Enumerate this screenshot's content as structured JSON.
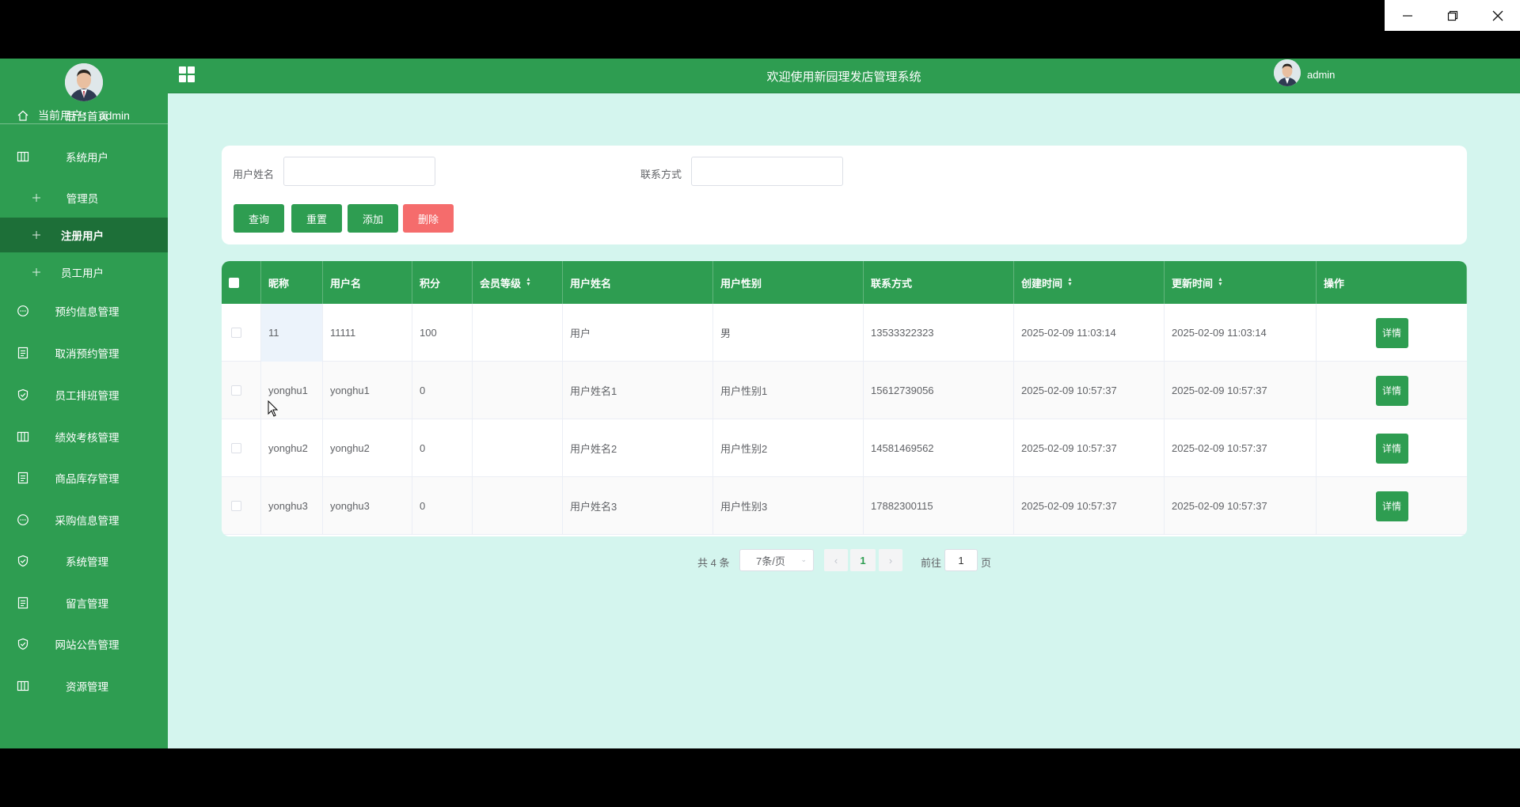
{
  "window": {
    "controls": [
      "minimize",
      "restore",
      "close"
    ]
  },
  "topbar": {
    "title": "欢迎使用新园理发店管理系统",
    "username": "admin"
  },
  "sidebar": {
    "current_user_label": "当前用户：",
    "current_user": "admin",
    "items": [
      {
        "label": "后台首页",
        "icon": "home-icon"
      },
      {
        "label": "系统用户",
        "icon": "columns-icon"
      },
      {
        "label": "管理员",
        "icon": "plus-icon",
        "sub": true
      },
      {
        "label": "注册用户",
        "icon": "plus-icon",
        "sub": true,
        "active": true
      },
      {
        "label": "员工用户",
        "icon": "plus-icon",
        "sub": true
      },
      {
        "label": "预约信息管理",
        "icon": "chat-icon"
      },
      {
        "label": "取消预约管理",
        "icon": "document-icon"
      },
      {
        "label": "员工排班管理",
        "icon": "shield-icon"
      },
      {
        "label": "绩效考核管理",
        "icon": "columns-icon"
      },
      {
        "label": "商品库存管理",
        "icon": "document-icon"
      },
      {
        "label": "采购信息管理",
        "icon": "chat-icon"
      },
      {
        "label": "系统管理",
        "icon": "shield-icon"
      },
      {
        "label": "留言管理",
        "icon": "document-icon"
      },
      {
        "label": "网站公告管理",
        "icon": "shield-icon"
      },
      {
        "label": "资源管理",
        "icon": "columns-icon"
      }
    ]
  },
  "search": {
    "name_label": "用户姓名",
    "name_value": "",
    "contact_label": "联系方式",
    "contact_value": "",
    "buttons": {
      "query": "查询",
      "reset": "重置",
      "add": "添加",
      "delete": "删除"
    }
  },
  "table": {
    "columns": [
      "昵称",
      "用户名",
      "积分",
      "会员等级",
      "用户姓名",
      "用户性别",
      "联系方式",
      "创建时间",
      "更新时间",
      "操作"
    ],
    "detail_label": "详情",
    "rows": [
      {
        "nickname": "11",
        "username": "11111",
        "points": "100",
        "level": "",
        "realname": "用户",
        "gender": "男",
        "phone": "13533322323",
        "created": "2025-02-09 11:03:14",
        "updated": "2025-02-09 11:03:14"
      },
      {
        "nickname": "yonghu1",
        "username": "yonghu1",
        "points": "0",
        "level": "",
        "realname": "用户姓名1",
        "gender": "用户性别1",
        "phone": "15612739056",
        "created": "2025-02-09 10:57:37",
        "updated": "2025-02-09 10:57:37"
      },
      {
        "nickname": "yonghu2",
        "username": "yonghu2",
        "points": "0",
        "level": "",
        "realname": "用户姓名2",
        "gender": "用户性别2",
        "phone": "14581469562",
        "created": "2025-02-09 10:57:37",
        "updated": "2025-02-09 10:57:37"
      },
      {
        "nickname": "yonghu3",
        "username": "yonghu3",
        "points": "0",
        "level": "",
        "realname": "用户姓名3",
        "gender": "用户性别3",
        "phone": "17882300115",
        "created": "2025-02-09 10:57:37",
        "updated": "2025-02-09 10:57:37"
      }
    ]
  },
  "pagination": {
    "total": "共 4 条",
    "page_size": "7条/页",
    "current_page": "1",
    "goto_label": "前往",
    "goto_value": "1",
    "page_suffix": "页"
  },
  "colors": {
    "primary": "#2e9d51",
    "active_menu": "#1d6f38",
    "background": "#d4f5ee",
    "danger": "#f56c6c"
  }
}
